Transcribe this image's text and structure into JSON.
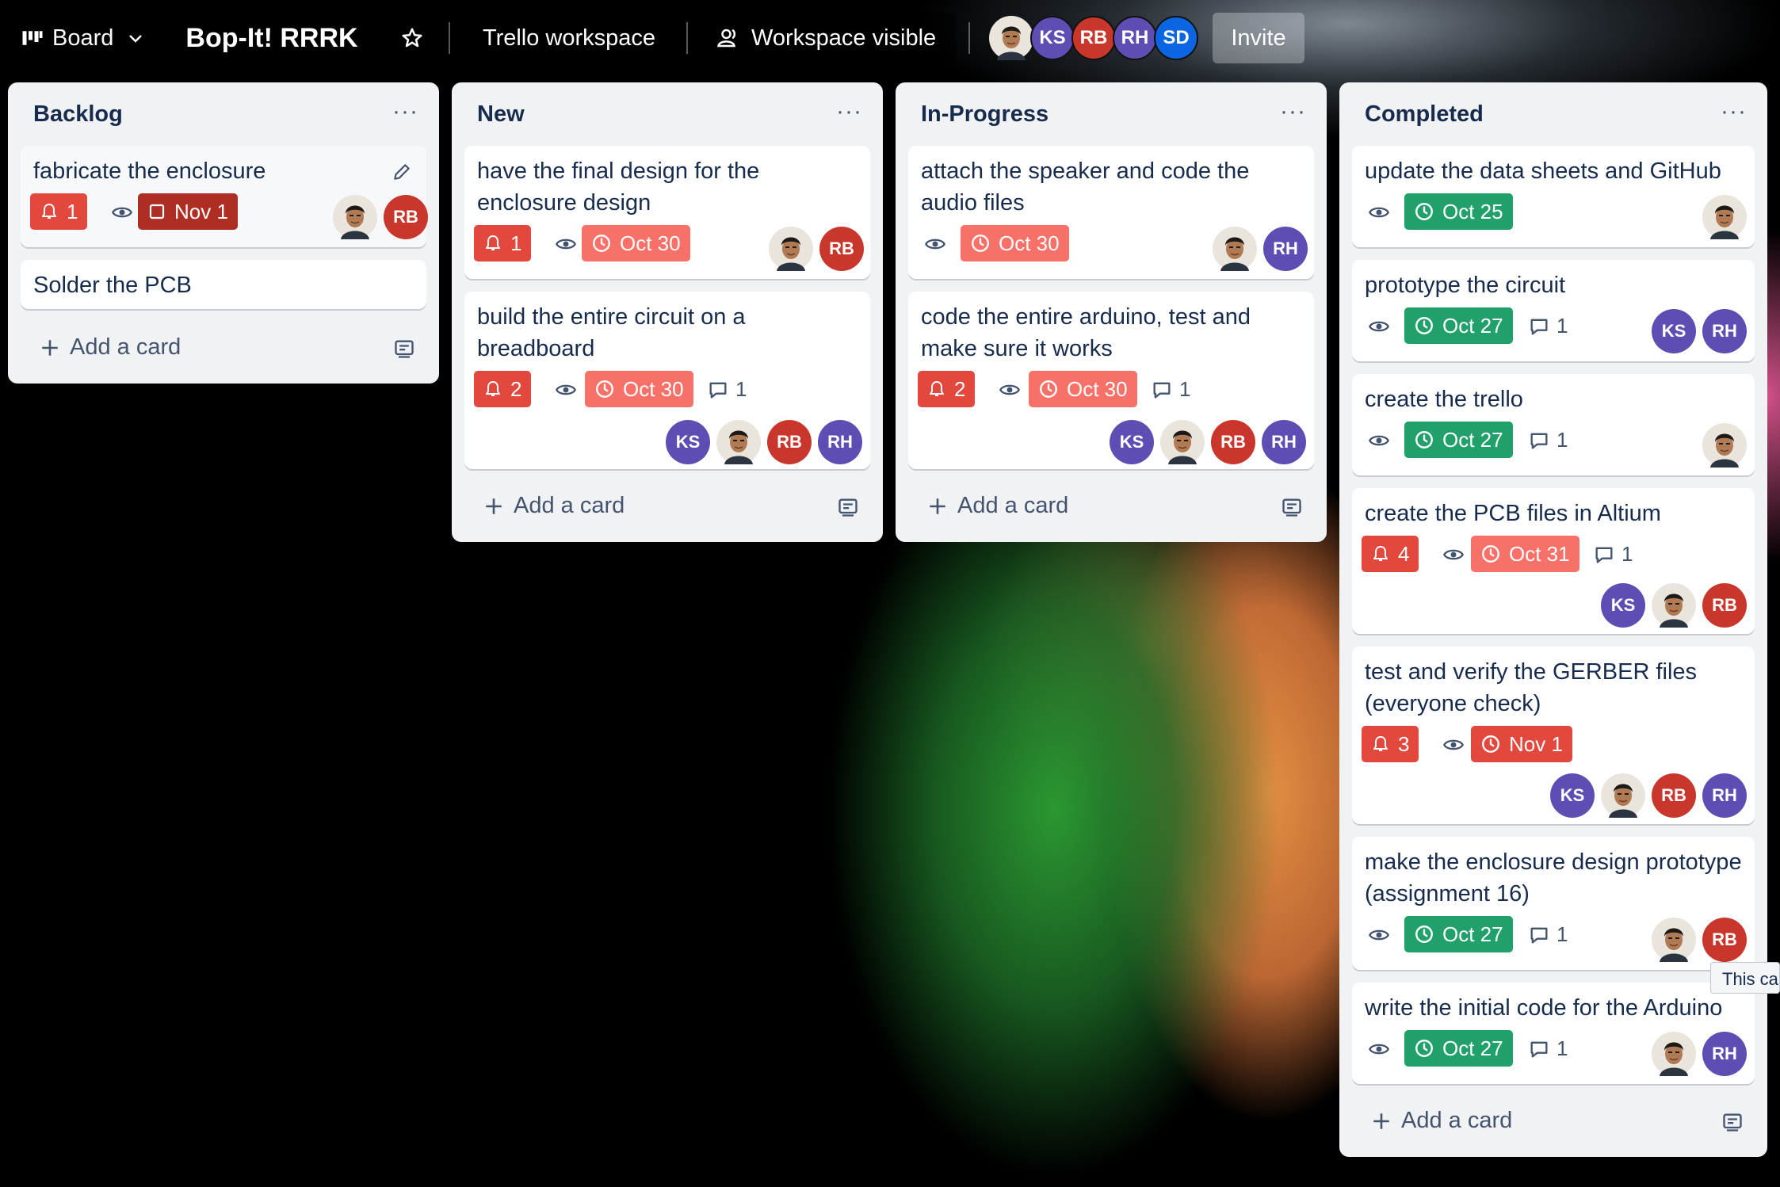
{
  "header": {
    "board_switcher": "Board",
    "board_title": "Bop-It! RRRK",
    "workspace": "Trello workspace",
    "visibility": "Workspace visible",
    "members": [
      "KS",
      "RB",
      "RH",
      "SD"
    ],
    "invite": "Invite"
  },
  "colors": {
    "ks": "#5e4db2",
    "rb": "#c9372c",
    "rh": "#5e4db2",
    "sd": "#0c66e4"
  },
  "lists": [
    {
      "title": "Backlog",
      "add_card": "Add a card",
      "cards": [
        {
          "title": "fabricate the enclosure",
          "notif": "1",
          "date": "Nov 1"
        },
        {
          "title": "Solder the PCB"
        }
      ]
    },
    {
      "title": "New",
      "add_card": "Add a card",
      "cards": [
        {
          "title_lines": [
            "have the final design for the",
            "enclosure design"
          ],
          "notif": "1",
          "date": "Oct 30"
        },
        {
          "title_lines": [
            "build the entire circuit on a",
            "breadboard"
          ],
          "notif": "2",
          "date": "Oct 30",
          "comments": "1"
        }
      ]
    },
    {
      "title": "In-Progress",
      "add_card": "Add a card",
      "cards": [
        {
          "title_lines": [
            "attach the speaker and code the",
            "audio files"
          ],
          "date": "Oct 30"
        },
        {
          "title_lines": [
            "code the entire arduino, test and",
            "make sure it works"
          ],
          "notif": "2",
          "date": "Oct 30",
          "comments": "1"
        }
      ]
    },
    {
      "title": "Completed",
      "add_card": "Add a card",
      "cards": [
        {
          "title": "update the data sheets and GitHub",
          "date": "Oct 25"
        },
        {
          "title": "prototype the circuit",
          "date": "Oct 27",
          "comments": "1"
        },
        {
          "title": "create the trello",
          "date": "Oct 27",
          "comments": "1"
        },
        {
          "title": "create the PCB files in Altium",
          "notif": "4",
          "date": "Oct 31",
          "comments": "1"
        },
        {
          "title_lines": [
            "test and verify the GERBER files",
            "(everyone check)"
          ],
          "notif": "3",
          "date": "Nov 1"
        },
        {
          "title_lines": [
            "make the enclosure design prototype",
            "(assignment 16)"
          ],
          "date": "Oct 27",
          "comments": "1"
        },
        {
          "title": "write the initial code for the Arduino",
          "date": "Oct 27",
          "comments": "1"
        }
      ]
    }
  ],
  "avatars": {
    "ks": "KS",
    "rb": "RB",
    "rh": "RH"
  },
  "tooltip": "This ca"
}
